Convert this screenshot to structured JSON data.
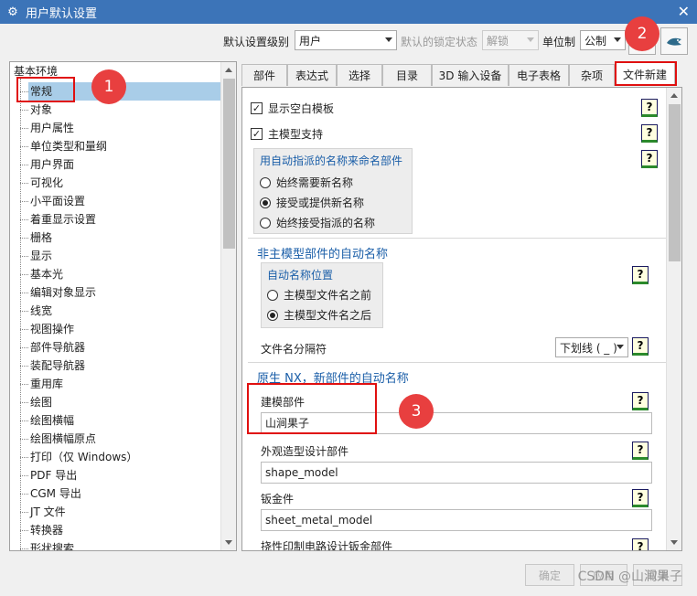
{
  "window": {
    "title": "用户默认设置",
    "close": "✕",
    "icon": "⚙"
  },
  "toolbar": {
    "level_label": "默认设置级别",
    "level_value": "用户",
    "lock_label": "默认的锁定状态",
    "lock_value": "解锁",
    "unit_label": "单位制",
    "unit_value": "公制",
    "icon_btn1": "gear-icon",
    "icon_btn2": "bird-icon"
  },
  "tree": {
    "root": "基本环境",
    "items": [
      "常规",
      "对象",
      "用户属性",
      "单位类型和量纲",
      "用户界面",
      "可视化",
      "小平面设置",
      "着重显示设置",
      "栅格",
      "显示",
      "基本光",
      "编辑对象显示",
      "线宽",
      "视图操作",
      "部件导航器",
      "装配导航器",
      "重用库",
      "绘图",
      "绘图横幅",
      "绘图横幅原点",
      "打印（仅 Windows）",
      "PDF 导出",
      "CGM 导出",
      "JT 文件",
      "转换器",
      "形状搜索"
    ]
  },
  "tabs": [
    "部件",
    "表达式",
    "选择",
    "目录",
    "3D 输入设备",
    "电子表格",
    "杂项",
    "文件新建"
  ],
  "panel": {
    "show_blank_template": "显示空白模板",
    "master_model_support": "主模型支持",
    "auto_name_group": "用自动指派的名称来命名部件",
    "radio_always_new": "始终需要新名称",
    "radio_accept_new": "接受或提供新名称",
    "radio_always_accept": "始终接受指派的名称",
    "non_master_title": "非主模型部件的自动名称",
    "auto_pos_group": "自动名称位置",
    "radio_before": "主模型文件名之前",
    "radio_after": "主模型文件名之后",
    "separator_label": "文件名分隔符",
    "separator_value": "下划线 ( _ )",
    "native_title": "原生 NX，新部件的自动名称",
    "modeling_label": "建模部件",
    "modeling_value": "山涧果子",
    "shape_label": "外观造型设计部件",
    "shape_value": "shape_model",
    "sheet_label": "钣金件",
    "sheet_value": "sheet_metal_model",
    "pcb_label": "挠性印制电路设计钣金部件",
    "help": "?"
  },
  "buttons": {
    "ok": "确定",
    "apply": "应用",
    "cancel": "取消"
  },
  "watermark": "CSDN @山涧果子",
  "annotations": [
    "1",
    "2",
    "3"
  ]
}
